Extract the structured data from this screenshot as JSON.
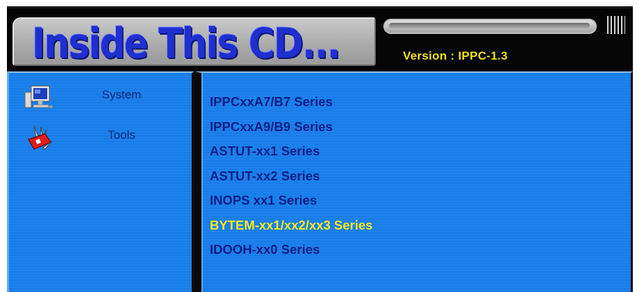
{
  "header": {
    "title": "Inside This CD...",
    "version": "Version : IPPC-1.3"
  },
  "sidebar": {
    "items": [
      {
        "label": "System",
        "icon": "computer-monitor-icon"
      },
      {
        "label": "Tools",
        "icon": "swiss-army-knife-icon"
      }
    ]
  },
  "main": {
    "series": [
      {
        "label": "IPPCxxA7/B7 Series",
        "active": false
      },
      {
        "label": "IPPCxxA9/B9 Series",
        "active": false
      },
      {
        "label": "ASTUT-xx1 Series",
        "active": false
      },
      {
        "label": "ASTUT-xx2 Series",
        "active": false
      },
      {
        "label": "INOPS xx1 Series",
        "active": false
      },
      {
        "label": "BYTEM-xx1/xx2/xx3 Series",
        "active": true
      },
      {
        "label": "IDOOH-xx0 Series",
        "active": false
      }
    ]
  },
  "colors": {
    "panel_blue": "#1c80ea",
    "link_text": "#0a1e86",
    "active_text": "#f7ea1a",
    "title_blue": "#1f2fd0"
  }
}
